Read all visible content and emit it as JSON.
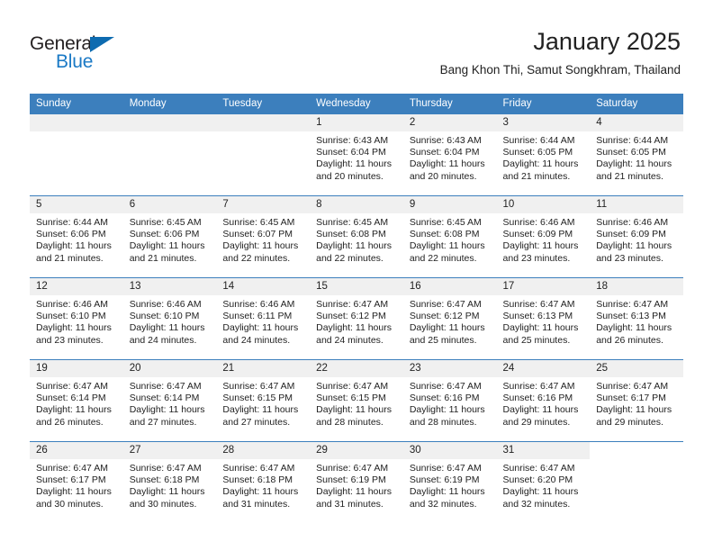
{
  "brand": {
    "name_top": "General",
    "name_bottom": "Blue",
    "accent_color": "#1a79c5",
    "triangle_color": "#0d6bb0"
  },
  "header": {
    "title": "January 2025",
    "subtitle": "Bang Khon Thi, Samut Songkhram, Thailand"
  },
  "theme": {
    "header_bar_color": "#3c7fbd",
    "daynum_band_color": "#f0f0f0",
    "text_color": "#222222"
  },
  "weekday_headers": [
    "Sunday",
    "Monday",
    "Tuesday",
    "Wednesday",
    "Thursday",
    "Friday",
    "Saturday"
  ],
  "weeks": [
    [
      {
        "day": "",
        "empty": true,
        "sunrise": "",
        "sunset": "",
        "daylight_1": "",
        "daylight_2": ""
      },
      {
        "day": "",
        "empty": true,
        "sunrise": "",
        "sunset": "",
        "daylight_1": "",
        "daylight_2": ""
      },
      {
        "day": "",
        "empty": true,
        "sunrise": "",
        "sunset": "",
        "daylight_1": "",
        "daylight_2": ""
      },
      {
        "day": "1",
        "sunrise": "Sunrise: 6:43 AM",
        "sunset": "Sunset: 6:04 PM",
        "daylight_1": "Daylight: 11 hours",
        "daylight_2": "and 20 minutes."
      },
      {
        "day": "2",
        "sunrise": "Sunrise: 6:43 AM",
        "sunset": "Sunset: 6:04 PM",
        "daylight_1": "Daylight: 11 hours",
        "daylight_2": "and 20 minutes."
      },
      {
        "day": "3",
        "sunrise": "Sunrise: 6:44 AM",
        "sunset": "Sunset: 6:05 PM",
        "daylight_1": "Daylight: 11 hours",
        "daylight_2": "and 21 minutes."
      },
      {
        "day": "4",
        "sunrise": "Sunrise: 6:44 AM",
        "sunset": "Sunset: 6:05 PM",
        "daylight_1": "Daylight: 11 hours",
        "daylight_2": "and 21 minutes."
      }
    ],
    [
      {
        "day": "5",
        "sunrise": "Sunrise: 6:44 AM",
        "sunset": "Sunset: 6:06 PM",
        "daylight_1": "Daylight: 11 hours",
        "daylight_2": "and 21 minutes."
      },
      {
        "day": "6",
        "sunrise": "Sunrise: 6:45 AM",
        "sunset": "Sunset: 6:06 PM",
        "daylight_1": "Daylight: 11 hours",
        "daylight_2": "and 21 minutes."
      },
      {
        "day": "7",
        "sunrise": "Sunrise: 6:45 AM",
        "sunset": "Sunset: 6:07 PM",
        "daylight_1": "Daylight: 11 hours",
        "daylight_2": "and 22 minutes."
      },
      {
        "day": "8",
        "sunrise": "Sunrise: 6:45 AM",
        "sunset": "Sunset: 6:08 PM",
        "daylight_1": "Daylight: 11 hours",
        "daylight_2": "and 22 minutes."
      },
      {
        "day": "9",
        "sunrise": "Sunrise: 6:45 AM",
        "sunset": "Sunset: 6:08 PM",
        "daylight_1": "Daylight: 11 hours",
        "daylight_2": "and 22 minutes."
      },
      {
        "day": "10",
        "sunrise": "Sunrise: 6:46 AM",
        "sunset": "Sunset: 6:09 PM",
        "daylight_1": "Daylight: 11 hours",
        "daylight_2": "and 23 minutes."
      },
      {
        "day": "11",
        "sunrise": "Sunrise: 6:46 AM",
        "sunset": "Sunset: 6:09 PM",
        "daylight_1": "Daylight: 11 hours",
        "daylight_2": "and 23 minutes."
      }
    ],
    [
      {
        "day": "12",
        "sunrise": "Sunrise: 6:46 AM",
        "sunset": "Sunset: 6:10 PM",
        "daylight_1": "Daylight: 11 hours",
        "daylight_2": "and 23 minutes."
      },
      {
        "day": "13",
        "sunrise": "Sunrise: 6:46 AM",
        "sunset": "Sunset: 6:10 PM",
        "daylight_1": "Daylight: 11 hours",
        "daylight_2": "and 24 minutes."
      },
      {
        "day": "14",
        "sunrise": "Sunrise: 6:46 AM",
        "sunset": "Sunset: 6:11 PM",
        "daylight_1": "Daylight: 11 hours",
        "daylight_2": "and 24 minutes."
      },
      {
        "day": "15",
        "sunrise": "Sunrise: 6:47 AM",
        "sunset": "Sunset: 6:12 PM",
        "daylight_1": "Daylight: 11 hours",
        "daylight_2": "and 24 minutes."
      },
      {
        "day": "16",
        "sunrise": "Sunrise: 6:47 AM",
        "sunset": "Sunset: 6:12 PM",
        "daylight_1": "Daylight: 11 hours",
        "daylight_2": "and 25 minutes."
      },
      {
        "day": "17",
        "sunrise": "Sunrise: 6:47 AM",
        "sunset": "Sunset: 6:13 PM",
        "daylight_1": "Daylight: 11 hours",
        "daylight_2": "and 25 minutes."
      },
      {
        "day": "18",
        "sunrise": "Sunrise: 6:47 AM",
        "sunset": "Sunset: 6:13 PM",
        "daylight_1": "Daylight: 11 hours",
        "daylight_2": "and 26 minutes."
      }
    ],
    [
      {
        "day": "19",
        "sunrise": "Sunrise: 6:47 AM",
        "sunset": "Sunset: 6:14 PM",
        "daylight_1": "Daylight: 11 hours",
        "daylight_2": "and 26 minutes."
      },
      {
        "day": "20",
        "sunrise": "Sunrise: 6:47 AM",
        "sunset": "Sunset: 6:14 PM",
        "daylight_1": "Daylight: 11 hours",
        "daylight_2": "and 27 minutes."
      },
      {
        "day": "21",
        "sunrise": "Sunrise: 6:47 AM",
        "sunset": "Sunset: 6:15 PM",
        "daylight_1": "Daylight: 11 hours",
        "daylight_2": "and 27 minutes."
      },
      {
        "day": "22",
        "sunrise": "Sunrise: 6:47 AM",
        "sunset": "Sunset: 6:15 PM",
        "daylight_1": "Daylight: 11 hours",
        "daylight_2": "and 28 minutes."
      },
      {
        "day": "23",
        "sunrise": "Sunrise: 6:47 AM",
        "sunset": "Sunset: 6:16 PM",
        "daylight_1": "Daylight: 11 hours",
        "daylight_2": "and 28 minutes."
      },
      {
        "day": "24",
        "sunrise": "Sunrise: 6:47 AM",
        "sunset": "Sunset: 6:16 PM",
        "daylight_1": "Daylight: 11 hours",
        "daylight_2": "and 29 minutes."
      },
      {
        "day": "25",
        "sunrise": "Sunrise: 6:47 AM",
        "sunset": "Sunset: 6:17 PM",
        "daylight_1": "Daylight: 11 hours",
        "daylight_2": "and 29 minutes."
      }
    ],
    [
      {
        "day": "26",
        "sunrise": "Sunrise: 6:47 AM",
        "sunset": "Sunset: 6:17 PM",
        "daylight_1": "Daylight: 11 hours",
        "daylight_2": "and 30 minutes."
      },
      {
        "day": "27",
        "sunrise": "Sunrise: 6:47 AM",
        "sunset": "Sunset: 6:18 PM",
        "daylight_1": "Daylight: 11 hours",
        "daylight_2": "and 30 minutes."
      },
      {
        "day": "28",
        "sunrise": "Sunrise: 6:47 AM",
        "sunset": "Sunset: 6:18 PM",
        "daylight_1": "Daylight: 11 hours",
        "daylight_2": "and 31 minutes."
      },
      {
        "day": "29",
        "sunrise": "Sunrise: 6:47 AM",
        "sunset": "Sunset: 6:19 PM",
        "daylight_1": "Daylight: 11 hours",
        "daylight_2": "and 31 minutes."
      },
      {
        "day": "30",
        "sunrise": "Sunrise: 6:47 AM",
        "sunset": "Sunset: 6:19 PM",
        "daylight_1": "Daylight: 11 hours",
        "daylight_2": "and 32 minutes."
      },
      {
        "day": "31",
        "sunrise": "Sunrise: 6:47 AM",
        "sunset": "Sunset: 6:20 PM",
        "daylight_1": "Daylight: 11 hours",
        "daylight_2": "and 32 minutes."
      },
      {
        "day": "",
        "blank": true,
        "sunrise": "",
        "sunset": "",
        "daylight_1": "",
        "daylight_2": ""
      }
    ]
  ]
}
